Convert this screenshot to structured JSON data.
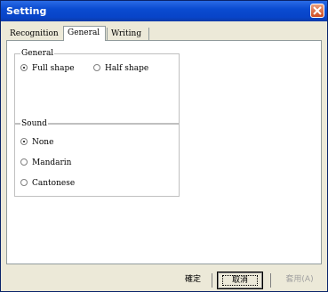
{
  "window": {
    "title": "Setting"
  },
  "tabs": [
    "Recognition",
    "General",
    "Writing"
  ],
  "groups": {
    "general": {
      "title": "General",
      "options": [
        {
          "label": "Full shape",
          "checked": true
        },
        {
          "label": "Half shape",
          "checked": false
        }
      ]
    },
    "sound": {
      "title": "Sound",
      "options": [
        {
          "label": "None",
          "checked": true
        },
        {
          "label": "Mandarin",
          "checked": false
        },
        {
          "label": "Cantonese",
          "checked": false
        }
      ]
    }
  },
  "buttons": {
    "ok": "確定",
    "cancel": "取消",
    "apply": "套用(A)"
  }
}
